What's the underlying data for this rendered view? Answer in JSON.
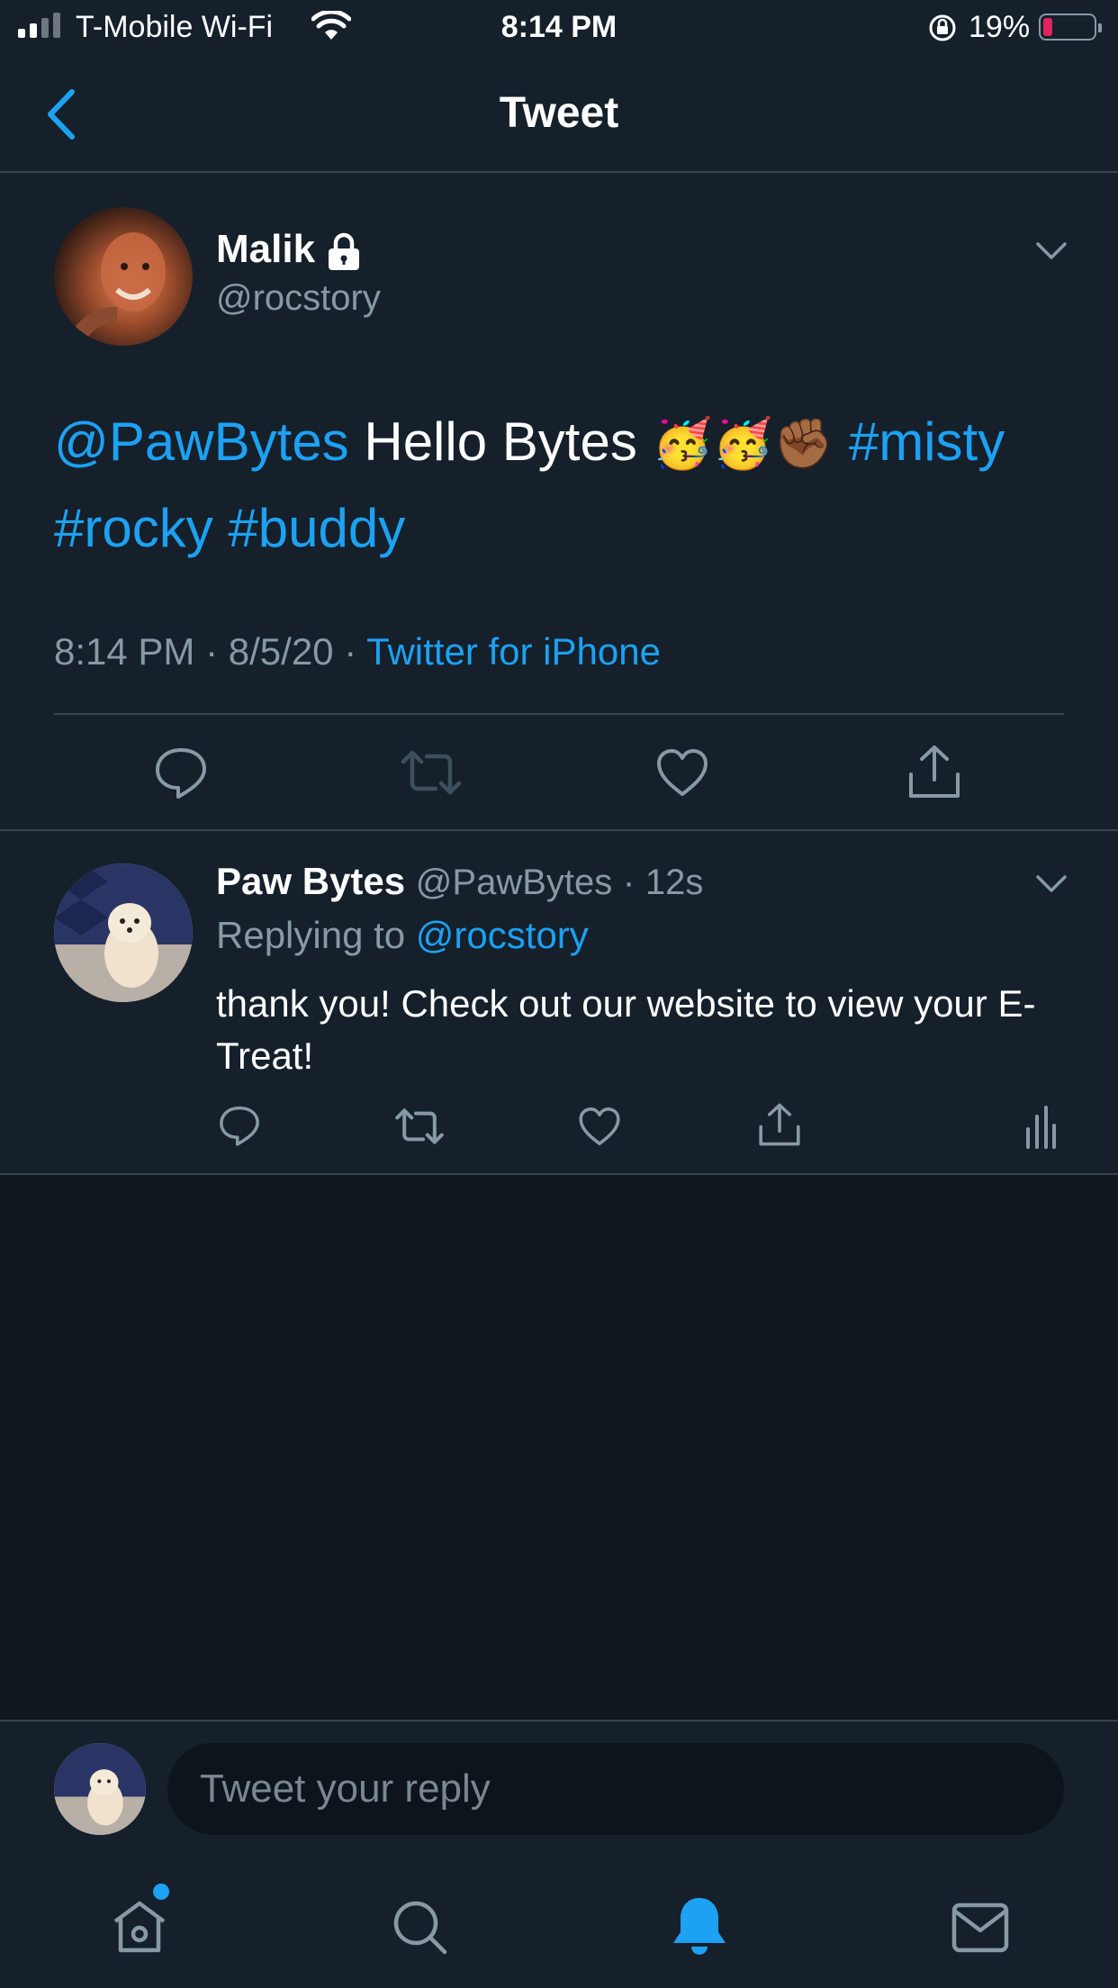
{
  "status_bar": {
    "carrier": "T-Mobile Wi-Fi",
    "time": "8:14 PM",
    "battery_percent": "19%",
    "battery_level": 0.19,
    "battery_color": "#e0245e"
  },
  "header": {
    "title": "Tweet",
    "back_icon": "chevron-left-icon"
  },
  "main_tweet": {
    "author_name": "Malik",
    "protected_icon": "lock-icon",
    "author_handle": "@rocstory",
    "text_mention": "@PawBytes",
    "text_body": " Hello Bytes ",
    "emojis": "🥳🥳✊🏾",
    "hashtag_1": "#misty",
    "hashtag_2": "#rocky",
    "hashtag_3": "#buddy",
    "time": "8:14 PM",
    "date": "8/5/20",
    "source": "Twitter for iPhone",
    "separator": "·",
    "actions": [
      "reply-icon",
      "retweet-icon",
      "like-icon",
      "share-icon"
    ]
  },
  "reply": {
    "author_name": "Paw Bytes",
    "author_handle": "@PawBytes",
    "age": "12s",
    "separator": "·",
    "replying_prefix": "Replying to",
    "replying_to": "@rocstory",
    "text": "thank you! Check out our website to view your E-Treat!",
    "actions": [
      "reply-icon",
      "retweet-icon",
      "like-icon",
      "share-icon",
      "analytics-icon"
    ]
  },
  "compose": {
    "placeholder": "Tweet your reply"
  },
  "tab_bar": {
    "items": [
      "home-icon",
      "search-icon",
      "notifications-icon",
      "messages-icon"
    ],
    "active": "notifications-icon",
    "accent": "#1da1f2"
  }
}
